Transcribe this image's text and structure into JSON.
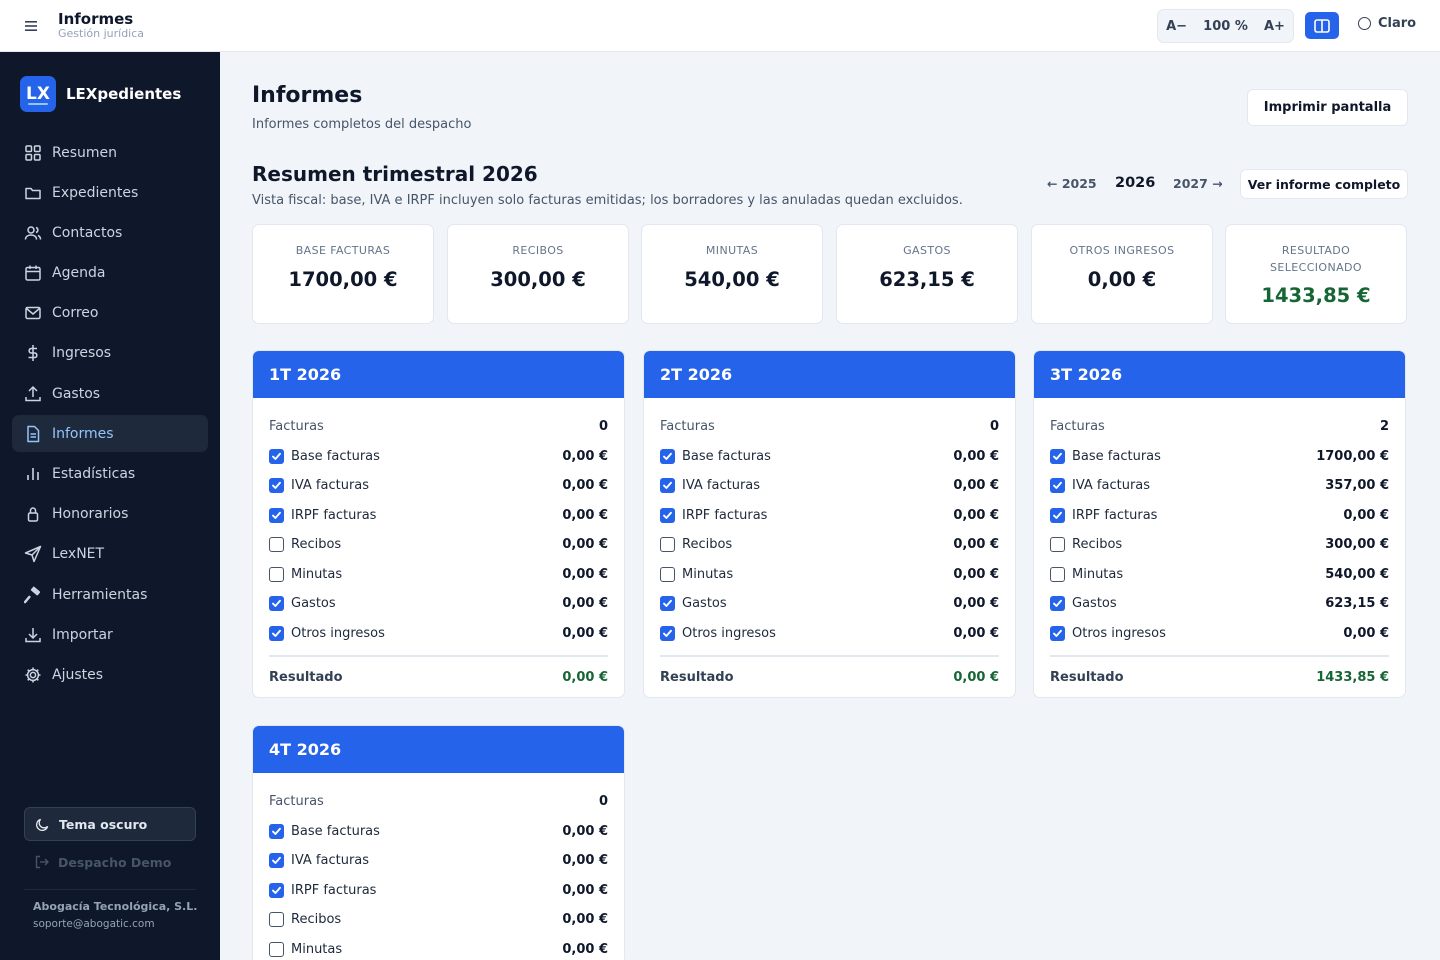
{
  "topbar": {
    "title": "Informes",
    "subtitle": "Gestión jurídica",
    "zoom_out": "A−",
    "zoom_level": "100 %",
    "zoom_in": "A+",
    "theme_label": "Claro"
  },
  "sidebar": {
    "brand_logo": "LX",
    "brand_name": "LEXpedientes",
    "items": [
      {
        "label": "Resumen",
        "icon": "grid-icon"
      },
      {
        "label": "Expedientes",
        "icon": "folder-icon"
      },
      {
        "label": "Contactos",
        "icon": "users-icon"
      },
      {
        "label": "Agenda",
        "icon": "calendar-icon"
      },
      {
        "label": "Correo",
        "icon": "mail-icon"
      },
      {
        "label": "Ingresos",
        "icon": "dollar-icon"
      },
      {
        "label": "Gastos",
        "icon": "upload-icon"
      },
      {
        "label": "Informes",
        "icon": "document-icon",
        "active": true
      },
      {
        "label": "Estadísticas",
        "icon": "bar-chart-icon"
      },
      {
        "label": "Honorarios",
        "icon": "lock-icon"
      },
      {
        "label": "LexNET",
        "icon": "send-icon"
      },
      {
        "label": "Herramientas",
        "icon": "hammer-icon"
      },
      {
        "label": "Importar",
        "icon": "download-icon"
      },
      {
        "label": "Ajustes",
        "icon": "gear-icon"
      }
    ],
    "dark_theme_label": "Tema oscuro",
    "logout_label": "Despacho Demo",
    "company": "Abogacía Tecnológica, S.L.",
    "support_email": "soporte@abogatic.com"
  },
  "header": {
    "title": "Informes",
    "subtitle": "Informes completos del despacho",
    "print_label": "Imprimir pantalla"
  },
  "summary": {
    "title": "Resumen trimestral 2026",
    "note": "Vista fiscal: base, IVA e IRPF incluyen solo facturas emitidas; los borradores y las anuladas quedan excluidos.",
    "prev_year": "← 2025",
    "current_year": "2026",
    "next_year": "2027 →",
    "full_report_label": "Ver informe completo"
  },
  "stats": [
    {
      "label": "BASE FACTURAS",
      "value": "1700,00 €"
    },
    {
      "label": "RECIBOS",
      "value": "300,00 €"
    },
    {
      "label": "MINUTAS",
      "value": "540,00 €"
    },
    {
      "label": "GASTOS",
      "value": "623,15 €"
    },
    {
      "label": "OTROS INGRESOS",
      "value": "0,00 €"
    },
    {
      "label": "RESULTADO SELECCIONADO",
      "value": "1433,85 €"
    }
  ],
  "quarters": [
    {
      "title": "1T 2026",
      "invoices_label": "Facturas",
      "invoices_count": "0",
      "rows": [
        {
          "label": "Base facturas",
          "value": "0,00 €",
          "checked": true
        },
        {
          "label": "IVA facturas",
          "value": "0,00 €",
          "checked": true
        },
        {
          "label": "IRPF facturas",
          "value": "0,00 €",
          "checked": true
        },
        {
          "label": "Recibos",
          "value": "0,00 €",
          "checked": false
        },
        {
          "label": "Minutas",
          "value": "0,00 €",
          "checked": false
        },
        {
          "label": "Gastos",
          "value": "0,00 €",
          "checked": true
        },
        {
          "label": "Otros ingresos",
          "value": "0,00 €",
          "checked": true
        }
      ],
      "result_label": "Resultado",
      "result_value": "0,00 €"
    },
    {
      "title": "2T 2026",
      "invoices_label": "Facturas",
      "invoices_count": "0",
      "rows": [
        {
          "label": "Base facturas",
          "value": "0,00 €",
          "checked": true
        },
        {
          "label": "IVA facturas",
          "value": "0,00 €",
          "checked": true
        },
        {
          "label": "IRPF facturas",
          "value": "0,00 €",
          "checked": true
        },
        {
          "label": "Recibos",
          "value": "0,00 €",
          "checked": false
        },
        {
          "label": "Minutas",
          "value": "0,00 €",
          "checked": false
        },
        {
          "label": "Gastos",
          "value": "0,00 €",
          "checked": true
        },
        {
          "label": "Otros ingresos",
          "value": "0,00 €",
          "checked": true
        }
      ],
      "result_label": "Resultado",
      "result_value": "0,00 €"
    },
    {
      "title": "3T 2026",
      "invoices_label": "Facturas",
      "invoices_count": "2",
      "rows": [
        {
          "label": "Base facturas",
          "value": "1700,00 €",
          "checked": true
        },
        {
          "label": "IVA facturas",
          "value": "357,00 €",
          "checked": true
        },
        {
          "label": "IRPF facturas",
          "value": "0,00 €",
          "checked": true
        },
        {
          "label": "Recibos",
          "value": "300,00 €",
          "checked": false
        },
        {
          "label": "Minutas",
          "value": "540,00 €",
          "checked": false
        },
        {
          "label": "Gastos",
          "value": "623,15 €",
          "checked": true
        },
        {
          "label": "Otros ingresos",
          "value": "0,00 €",
          "checked": true
        }
      ],
      "result_label": "Resultado",
      "result_value": "1433,85 €"
    },
    {
      "title": "4T 2026",
      "invoices_label": "Facturas",
      "invoices_count": "0",
      "rows": [
        {
          "label": "Base facturas",
          "value": "0,00 €",
          "checked": true
        },
        {
          "label": "IVA facturas",
          "value": "0,00 €",
          "checked": true
        },
        {
          "label": "IRPF facturas",
          "value": "0,00 €",
          "checked": true
        },
        {
          "label": "Recibos",
          "value": "0,00 €",
          "checked": false
        },
        {
          "label": "Minutas",
          "value": "0,00 €",
          "checked": false
        }
      ]
    }
  ],
  "colors": {
    "accent": "#2563eb",
    "sidebar_bg": "#0f172a",
    "positive": "#166534",
    "page_bg": "#f1f5f9"
  }
}
